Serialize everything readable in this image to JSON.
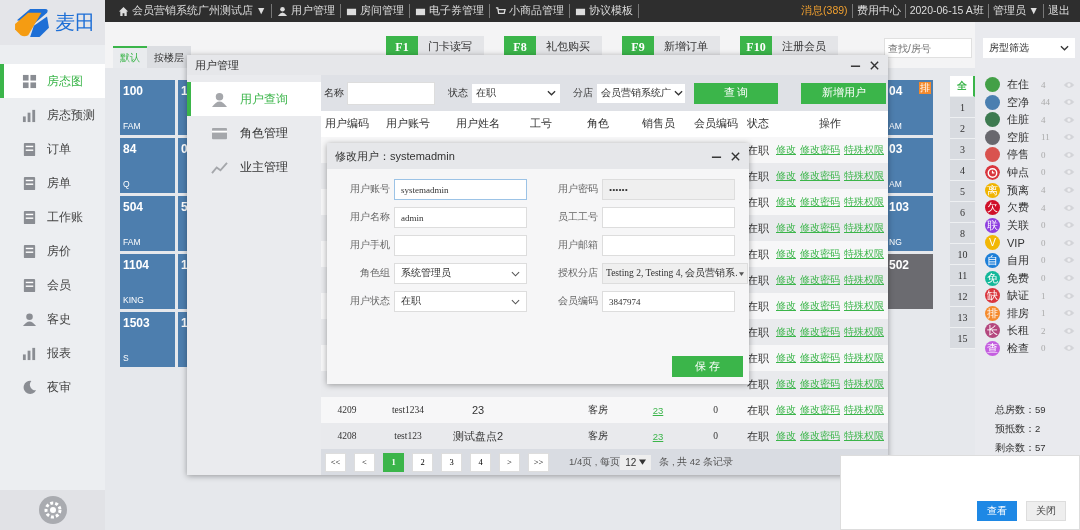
{
  "logo": {
    "text": "麦田"
  },
  "top_bar": {
    "menu": [
      {
        "label": "会员营销系统广州测试店 ▼"
      },
      {
        "label": "用户管理"
      },
      {
        "label": "房间管理"
      },
      {
        "label": "电子券管理"
      },
      {
        "label": "小商品管理"
      },
      {
        "label": "协议模板"
      }
    ],
    "right": [
      {
        "label": "消息(389)",
        "kind": "alert"
      },
      {
        "label": "费用中心",
        "kind": "link"
      },
      {
        "label": "2020-06-15 A班",
        "kind": "link"
      },
      {
        "label": "管理员 ▼",
        "kind": "link"
      },
      {
        "label": "退出",
        "kind": "link"
      }
    ]
  },
  "sidebar": {
    "items": [
      {
        "label": "房态图",
        "selected": true
      },
      {
        "label": "房态预测",
        "selected": false
      },
      {
        "label": "订单",
        "selected": false
      },
      {
        "label": "房单",
        "selected": false
      },
      {
        "label": "工作账",
        "selected": false
      },
      {
        "label": "房价",
        "selected": false
      },
      {
        "label": "会员",
        "selected": false
      },
      {
        "label": "客史",
        "selected": false
      },
      {
        "label": "报表",
        "selected": false
      },
      {
        "label": "夜审",
        "selected": false
      }
    ]
  },
  "function_keys": [
    {
      "key": "F1",
      "label": "门卡读写"
    },
    {
      "key": "F8",
      "label": "礼包购买"
    },
    {
      "key": "F9",
      "label": "新增订单"
    },
    {
      "key": "F10",
      "label": "注册会员"
    }
  ],
  "search": {
    "placeholder": "查找/房号"
  },
  "view_tabs": [
    {
      "label": "默认",
      "selected": true
    },
    {
      "label": "按楼层",
      "selected": false
    }
  ],
  "rooms": {
    "left_columns": [
      [
        {
          "number": "100",
          "type": "FAM",
          "color": "#4d7eae"
        },
        {
          "number": "84",
          "type": "Q",
          "color": "#4d7eae"
        },
        {
          "number": "504",
          "type": "FAM",
          "color": "#4d7eae"
        },
        {
          "number": "1104",
          "type": "KING",
          "color": "#4d7eae"
        },
        {
          "number": "1503",
          "type": "S",
          "color": "#4d7eae"
        }
      ],
      [
        {
          "number": "1",
          "color": "#4d7eae"
        },
        {
          "number": "0",
          "color": "#4d7eae"
        },
        {
          "number": "5",
          "color": "#4d7eae"
        },
        {
          "number": "1",
          "color": "#4d7eae"
        },
        {
          "number": "1",
          "color": "#4d7eae"
        }
      ]
    ],
    "right_column": [
      {
        "number": "04",
        "type": "AM",
        "color": "#4d7eae",
        "badge": "排"
      },
      {
        "number": "03",
        "type": "AM",
        "color": "#4d7eae"
      },
      {
        "number": "103",
        "type": "NG",
        "color": "#4d7eae"
      },
      {
        "number": "502",
        "color": "#6b6b70"
      }
    ]
  },
  "floors": [
    {
      "label": "全",
      "selected": true
    },
    {
      "label": "1",
      "selected": false
    },
    {
      "label": "2",
      "selected": false
    },
    {
      "label": "3",
      "selected": false
    },
    {
      "label": "4",
      "selected": false
    },
    {
      "label": "5",
      "selected": false
    },
    {
      "label": "6",
      "selected": false
    },
    {
      "label": "8",
      "selected": false
    },
    {
      "label": "10",
      "selected": false
    },
    {
      "label": "11",
      "selected": false
    },
    {
      "label": "12",
      "selected": false
    },
    {
      "label": "13",
      "selected": false
    },
    {
      "label": "15",
      "selected": false
    }
  ],
  "room_type_filter": {
    "value": "房型筛选"
  },
  "legend": [
    {
      "label": "在住",
      "count": "4",
      "kind": "dot",
      "color": "#43a047"
    },
    {
      "label": "空净",
      "count": "44",
      "kind": "dot",
      "color": "#4a7fb0"
    },
    {
      "label": "住脏",
      "count": "4",
      "kind": "dot",
      "color": "#3d7a50"
    },
    {
      "label": "空脏",
      "count": "11",
      "kind": "dot",
      "color": "#68686e"
    },
    {
      "label": "停售",
      "count": "0",
      "kind": "dot",
      "color": "#d9534f"
    },
    {
      "label": "钟点",
      "count": "0",
      "kind": "clock",
      "color": "#d9363e"
    },
    {
      "label": "预离",
      "count": "4",
      "kind": "glyph",
      "glyph": "离",
      "color": "#f0b400"
    },
    {
      "label": "欠费",
      "count": "4",
      "kind": "glyph",
      "glyph": "欠",
      "color": "#d0102a"
    },
    {
      "label": "关联",
      "count": "0",
      "kind": "glyph",
      "glyph": "联",
      "color": "#8e3ee0"
    },
    {
      "label": "VIP",
      "count": "0",
      "kind": "glyph",
      "glyph": "V",
      "color": "#f2b705"
    },
    {
      "label": "自用",
      "count": "0",
      "kind": "glyph",
      "glyph": "自",
      "color": "#1e7fd8"
    },
    {
      "label": "免费",
      "count": "0",
      "kind": "glyph",
      "glyph": "免",
      "color": "#14b89a"
    },
    {
      "label": "缺证",
      "count": "1",
      "kind": "glyph",
      "glyph": "缺",
      "color": "#d9363e"
    },
    {
      "label": "排房",
      "count": "1",
      "kind": "glyph",
      "glyph": "排",
      "color": "#f58a2c"
    },
    {
      "label": "长租",
      "count": "2",
      "kind": "glyph",
      "glyph": "长",
      "color": "#b4477e"
    },
    {
      "label": "检查",
      "count": "0",
      "kind": "glyph",
      "glyph": "查",
      "color": "#c45ee0"
    }
  ],
  "stats": [
    "总房数：59",
    "预抵数：2",
    "剩余数：57"
  ],
  "user_dialog": {
    "title": "用户管理",
    "nav": [
      {
        "label": "用户查询",
        "selected": true
      },
      {
        "label": "角色管理",
        "selected": false
      },
      {
        "label": "业主管理",
        "selected": false
      }
    ],
    "filters": {
      "name_label": "名称",
      "status_label": "状态",
      "status_value": "在职",
      "branch_label": "分店",
      "branch_value": "会员营销系统广"
    },
    "query_button": "查 询",
    "add_button": "新增用户",
    "columns": [
      "用户编码",
      "用户账号",
      "用户姓名",
      "工号",
      "角色",
      "销售员",
      "会员编码",
      "状态",
      "操作"
    ],
    "rows": [
      {
        "status": "在职",
        "actions": [
          "修改",
          "修改密码",
          "特殊权限"
        ]
      },
      {
        "status": "在职",
        "actions": [
          "修改",
          "修改密码",
          "特殊权限"
        ]
      },
      {
        "status": "在职",
        "actions": [
          "修改",
          "修改密码",
          "特殊权限"
        ]
      },
      {
        "status": "在职",
        "actions": [
          "修改",
          "修改密码",
          "特殊权限"
        ]
      },
      {
        "status": "在职",
        "actions": [
          "修改",
          "修改密码",
          "特殊权限"
        ]
      },
      {
        "status": "在职",
        "actions": [
          "修改",
          "修改密码",
          "特殊权限"
        ]
      },
      {
        "status": "在职",
        "actions": [
          "修改",
          "修改密码",
          "特殊权限"
        ]
      },
      {
        "status": "在职",
        "actions": [
          "修改",
          "修改密码",
          "特殊权限"
        ]
      },
      {
        "status": "在职",
        "actions": [
          "修改",
          "修改密码",
          "特殊权限"
        ]
      },
      {
        "status": "在职",
        "actions": [
          "修改",
          "修改密码",
          "特殊权限"
        ]
      },
      {
        "code": "4209",
        "account": "test1234",
        "name": "23",
        "role": "客房",
        "sales": "23",
        "member_code": "0",
        "status": "在职",
        "actions": [
          "修改",
          "修改密码",
          "特殊权限"
        ]
      },
      {
        "code": "4208",
        "account": "test123",
        "name": "测试盘点2",
        "role": "客房",
        "sales": "23",
        "member_code": "0",
        "status": "在职",
        "actions": [
          "修改",
          "修改密码",
          "特殊权限"
        ]
      }
    ],
    "pagination": {
      "buttons": [
        {
          "label": "<<",
          "selected": false
        },
        {
          "label": "<",
          "selected": false
        },
        {
          "label": "1",
          "selected": true
        },
        {
          "label": "2",
          "selected": false
        },
        {
          "label": "3",
          "selected": false
        },
        {
          "label": "4",
          "selected": false
        },
        {
          "label": ">",
          "selected": false
        },
        {
          "label": ">>",
          "selected": false
        }
      ],
      "info_before": "1/4页 , 每页",
      "page_size": "12",
      "info_after": "条 , 共 42 条记录"
    }
  },
  "edit_dialog": {
    "title": "修改用户：systemadmin",
    "fields": [
      {
        "label": "用户账号",
        "value": "systemadmin",
        "kind": "text",
        "focused": true,
        "disabled": false
      },
      {
        "label": "用户密码",
        "value": "••••••",
        "kind": "text",
        "focused": false,
        "disabled": true
      },
      {
        "label": "用户名称",
        "value": "admin",
        "kind": "text",
        "focused": false,
        "disabled": false
      },
      {
        "label": "员工工号",
        "kind": "text",
        "focused": false,
        "disabled": false
      },
      {
        "label": "用户手机",
        "kind": "text",
        "focused": false,
        "disabled": false
      },
      {
        "label": "用户邮箱",
        "kind": "text",
        "focused": false,
        "disabled": false
      },
      {
        "label": "角色组",
        "value": "系统管理员",
        "kind": "select",
        "focused": false,
        "disabled": false
      },
      {
        "label": "授权分店",
        "value": "Testing 2, Testing 4, 会员营销系.",
        "kind": "multiselect",
        "focused": false,
        "disabled": true
      },
      {
        "label": "用户状态",
        "value": "在职",
        "kind": "select",
        "focused": false,
        "disabled": false
      },
      {
        "label": "会员编码",
        "value": "3847974",
        "kind": "text",
        "focused": false,
        "disabled": false
      }
    ],
    "save_button": "保 存"
  },
  "notification": {
    "buttons": [
      {
        "label": "查看",
        "kind": "primary"
      },
      {
        "label": "关闭",
        "kind": "secondary"
      }
    ]
  }
}
